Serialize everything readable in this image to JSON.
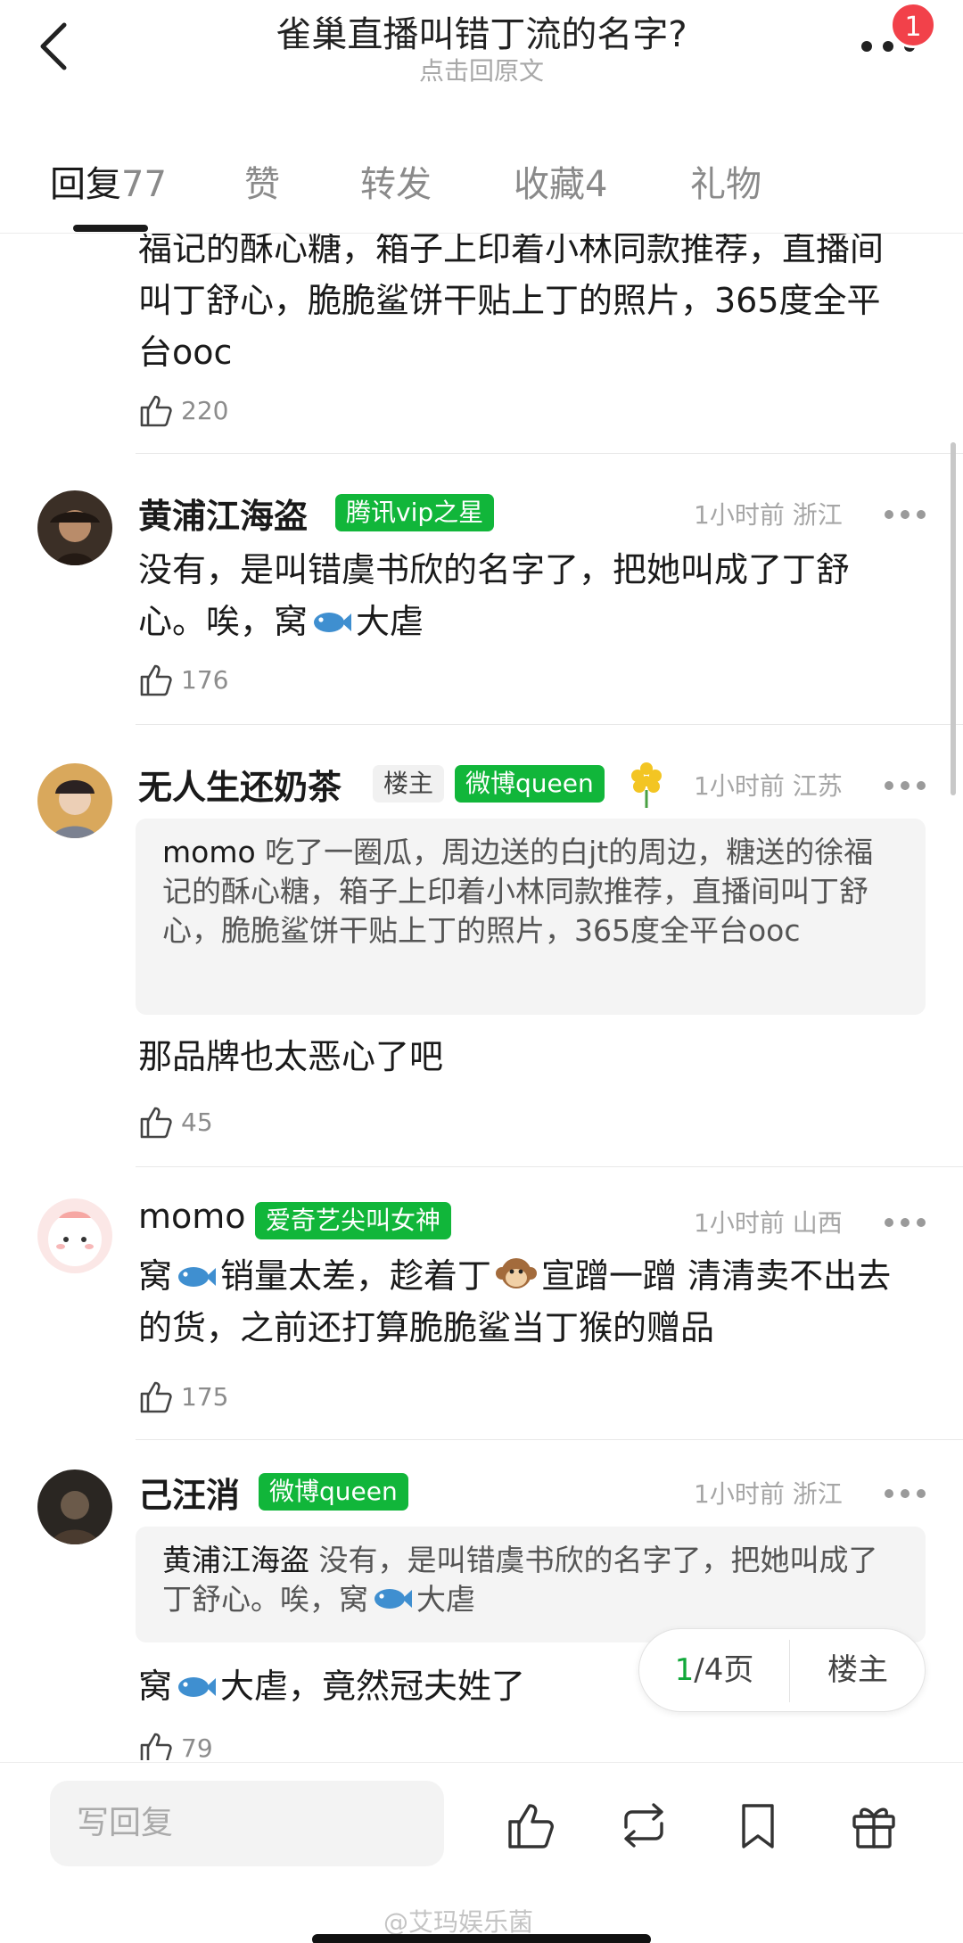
{
  "header": {
    "title": "雀巢直播叫错丁流的名字?",
    "subtitle": "点击回原文",
    "notification_count": "1"
  },
  "tabs": [
    {
      "label": "回复",
      "count": "77",
      "active": true
    },
    {
      "label": "赞",
      "count": ""
    },
    {
      "label": "转发",
      "count": ""
    },
    {
      "label": "收藏",
      "count": "4"
    },
    {
      "label": "礼物",
      "count": ""
    }
  ],
  "comments": [
    {
      "text": "福记的酥心糖，箱子上印着小林同款推荐，直播间叫丁舒心，脆脆鲨饼干贴上丁的照片，365度全平台ooc",
      "likes": "220"
    },
    {
      "username": "黄浦江海盗",
      "tags": [
        "腾讯vip之星"
      ],
      "time": "1小时前",
      "location": "浙江",
      "text_before": "没有，是叫错虞书欣的名字了，把她叫成了丁舒心。唉，窝",
      "text_after": "大虐",
      "likes": "176"
    },
    {
      "username": "无人生还奶茶",
      "owner_tag": "楼主",
      "tags": [
        "微博queen"
      ],
      "time": "1小时前",
      "location": "江苏",
      "quote_user": "momo",
      "quote_text": "吃了一圈瓜，周边送的白jt的周边，糖送的徐福记的酥心糖，箱子上印着小林同款推荐，直播间叫丁舒心，脆脆鲨饼干贴上丁的照片，365度全平台ooc",
      "text": "那品牌也太恶心了吧",
      "likes": "45"
    },
    {
      "username": "momo",
      "tags": [
        "爱奇艺尖叫女神"
      ],
      "time": "1小时前",
      "location": "山西",
      "text_a": "窝",
      "text_b": "销量太差，趁着丁",
      "text_c": "宣蹭一蹭 清清卖不出去的货，之前还打算脆脆鲨当丁猴的赠品",
      "likes": "175"
    },
    {
      "username": "己汪消",
      "tags": [
        "微博queen"
      ],
      "time": "1小时前",
      "location": "浙江",
      "quote_user": "黄浦江海盗",
      "quote_text_before": "没有，是叫错虞书欣的名字了，把她叫成了丁舒心。唉，窝",
      "quote_text_after": "大虐",
      "text_before": "窝",
      "text_after": "大虐，竟然冠夫姓了",
      "likes": "79"
    }
  ],
  "pager": {
    "current": "1",
    "total": "/4页",
    "owner_label": "楼主"
  },
  "bottom": {
    "reply_placeholder": "写回复",
    "watermark": "@艾玛娱乐菌"
  },
  "colors": {
    "accent_green": "#11b63a",
    "badge_red": "#f2414a"
  }
}
